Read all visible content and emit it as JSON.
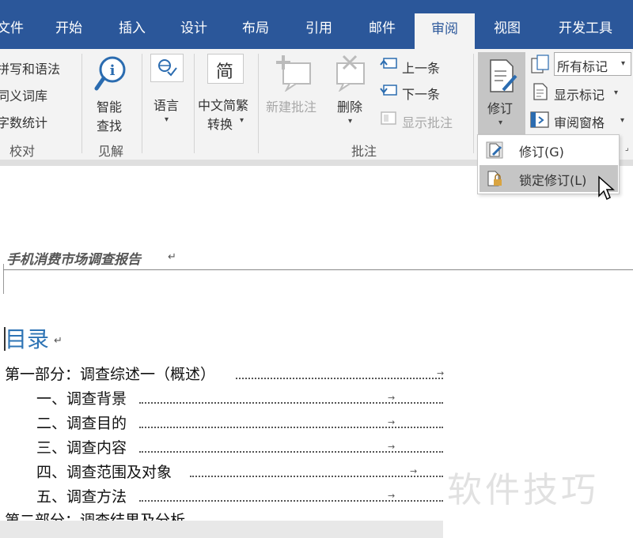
{
  "tabs": [
    {
      "label": "文件"
    },
    {
      "label": "开始"
    },
    {
      "label": "插入"
    },
    {
      "label": "设计"
    },
    {
      "label": "布局"
    },
    {
      "label": "引用"
    },
    {
      "label": "邮件"
    },
    {
      "label": "审阅"
    },
    {
      "label": "视图"
    },
    {
      "label": "开发工具"
    }
  ],
  "ribbon": {
    "proofing": {
      "items": [
        "拼写和语法",
        "同义词库",
        "字数统计"
      ],
      "group_label": "校对"
    },
    "insights": {
      "button": "智能\n查找",
      "line1": "智能",
      "line2": "查找",
      "group_label": "见解"
    },
    "language": {
      "label": "语言"
    },
    "chinese": {
      "line1": "中文简繁",
      "line2": "转换",
      "glyph": "简"
    },
    "comments": {
      "new_comment": "新建批注",
      "delete": "删除",
      "previous": "上一条",
      "next": "下一条",
      "show_comments": "显示批注",
      "group_label": "批注"
    },
    "tracking": {
      "track_changes": "修订",
      "markup_select": "所有标记",
      "show_markup": "显示标记",
      "reviewing_pane": "审阅窗格"
    }
  },
  "dropdown": {
    "items": [
      {
        "label": "修订(G)"
      },
      {
        "label": "锁定修订(L)"
      }
    ]
  },
  "document": {
    "header": "手机消费市场调查报告",
    "toc_title": "目录",
    "toc": [
      {
        "text": "第一部分：调查综述一（概述）"
      },
      {
        "text": "一、调查背景"
      },
      {
        "text": "二、调查目的"
      },
      {
        "text": "三、调查内容"
      },
      {
        "text": "四、调查范围及对象"
      },
      {
        "text": "五、调查方法"
      },
      {
        "text": "第二部分：调查结果及分析"
      }
    ]
  },
  "watermark": "软件技巧",
  "colors": {
    "brand": "#2b579a",
    "heading": "#2e74b5",
    "ribbon_bg": "#f3f3f3"
  }
}
